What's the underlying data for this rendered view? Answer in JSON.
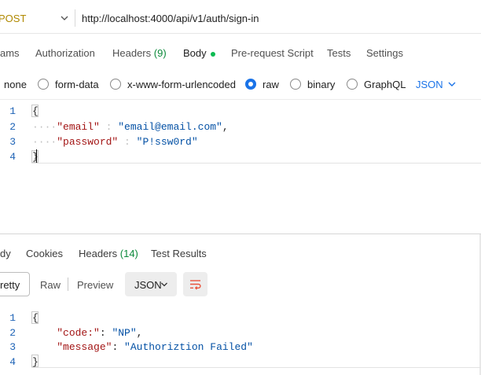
{
  "request": {
    "method": "POST",
    "url": "http://localhost:4000/api/v1/auth/sign-in",
    "tabs": [
      {
        "label": "ams"
      },
      {
        "label": "Authorization"
      },
      {
        "label": "Headers",
        "count": "(9)"
      },
      {
        "label": "Body"
      },
      {
        "label": "Pre-request Script"
      },
      {
        "label": "Tests"
      },
      {
        "label": "Settings"
      }
    ],
    "body_types": [
      "none",
      "form-data",
      "x-www-form-urlencoded",
      "raw",
      "binary",
      "GraphQL"
    ],
    "body_types_selected": "raw",
    "format": "JSON",
    "editor": {
      "line_numbers": [
        "1",
        "2",
        "3",
        "4"
      ],
      "open_brace": "{",
      "close_brace": "}",
      "lines": [
        {
          "key": "\"email\"",
          "sep": " : ",
          "value": "\"email@email.com\"",
          "trail": ","
        },
        {
          "key": "\"password\"",
          "sep": " : ",
          "value": "\"P!ssw0rd\"",
          "trail": ""
        }
      ]
    }
  },
  "response": {
    "tabs": [
      {
        "label": "dy"
      },
      {
        "label": "Cookies"
      },
      {
        "label": "Headers",
        "count": "(14)"
      },
      {
        "label": "Test Results"
      }
    ],
    "view_modes": [
      "retty",
      "Raw",
      "Preview"
    ],
    "format": "JSON",
    "editor": {
      "line_numbers": [
        "1",
        "2",
        "3",
        "4"
      ],
      "open_brace": "{",
      "close_brace": "}",
      "lines": [
        {
          "key": "\"code:\"",
          "sep": ": ",
          "value": "\"NP\"",
          "trail": ","
        },
        {
          "key": "\"message\"",
          "sep": ": ",
          "value": "\"Authoriztion Failed\"",
          "trail": ""
        }
      ]
    }
  },
  "colors": {
    "accent": "#1a73e8",
    "method": "#b08900",
    "count": "#0c8a3b",
    "dot": "#0cbb52",
    "json_key": "#a31515",
    "json_string": "#0451a5",
    "wrap_icon": "#e8553d"
  },
  "icons": [
    "chevron-down-icon",
    "word-wrap-icon"
  ]
}
